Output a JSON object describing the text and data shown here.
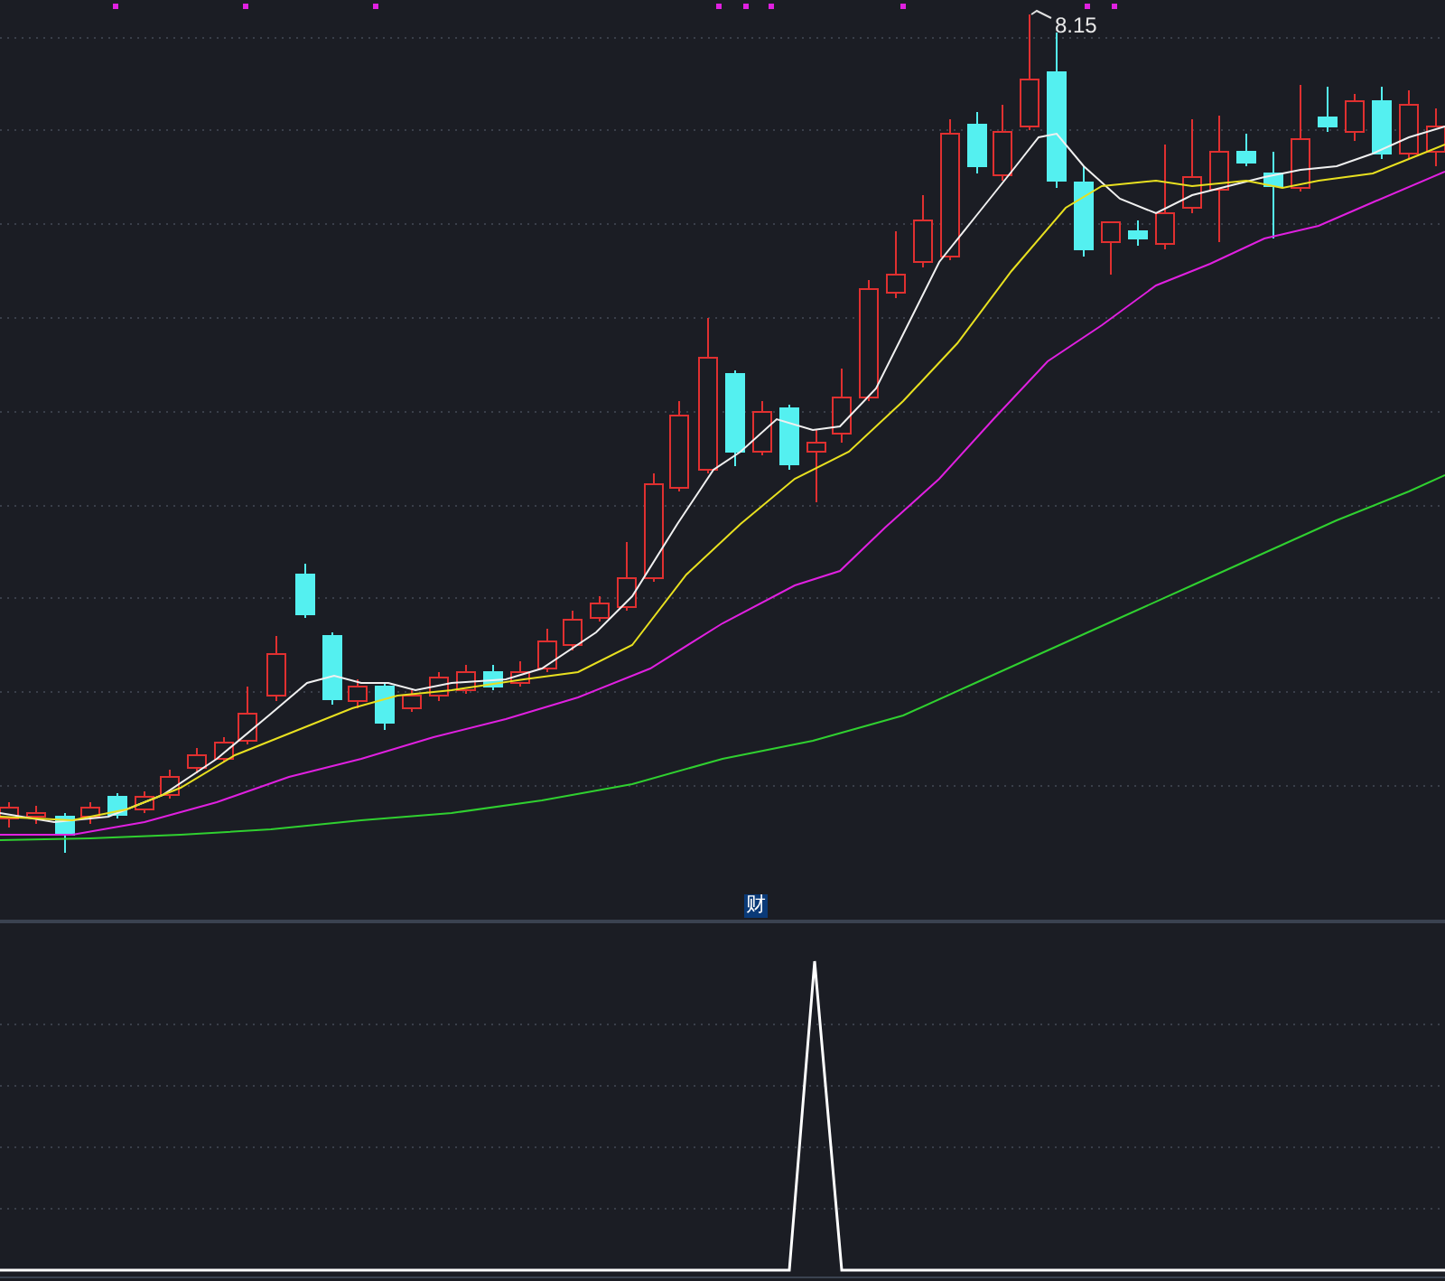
{
  "main_chart": {
    "high_label": "8.15"
  },
  "indicator_panel": {
    "tab_label": "财"
  }
}
